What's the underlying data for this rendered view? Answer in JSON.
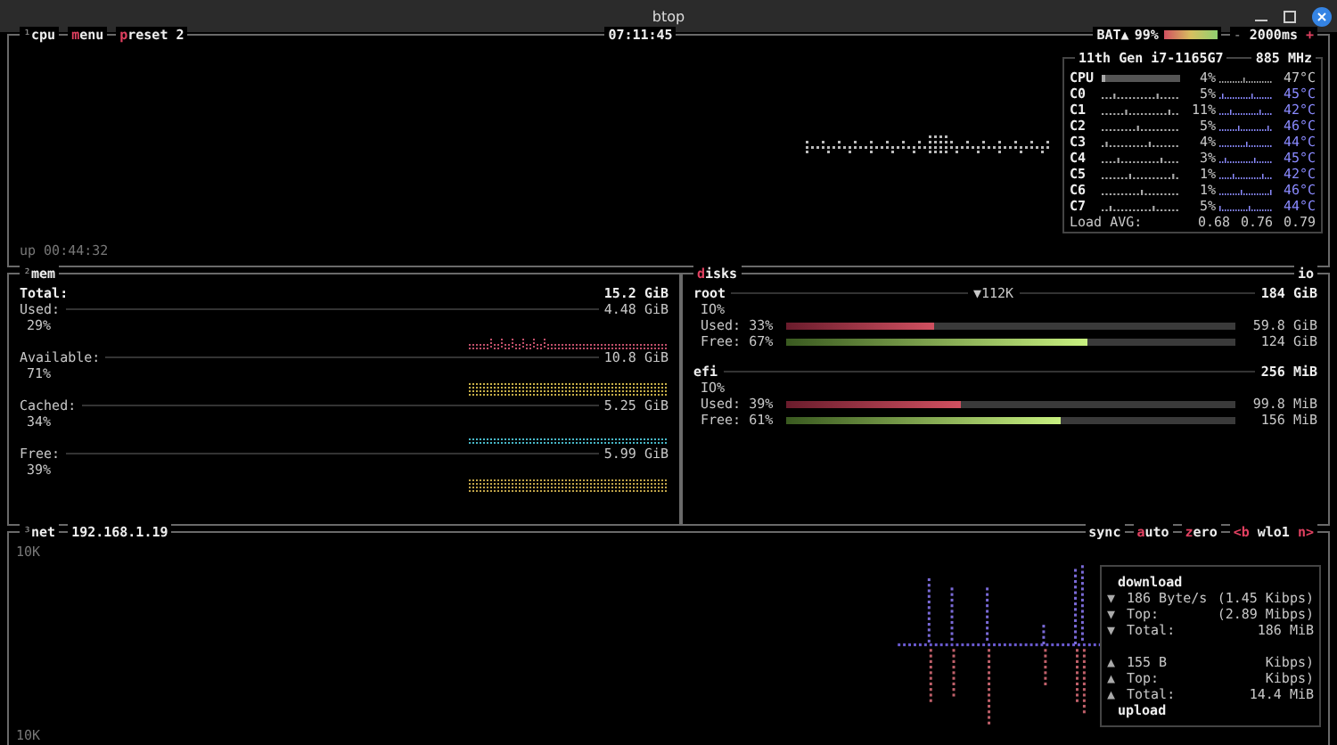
{
  "window": {
    "title": "btop"
  },
  "cpu": {
    "tags": [
      {
        "kind": "numbered",
        "key": "¹",
        "text": "cpu"
      },
      {
        "kind": "hotkey",
        "key": "m",
        "text": "enu"
      },
      {
        "kind": "hotkey",
        "key": "p",
        "text": "reset 2"
      }
    ],
    "clock": "07:11:45",
    "battery": {
      "label": "BAT▲",
      "reading": "99%",
      "level": 0.99
    },
    "interval": {
      "minus": "-",
      "text": "2000ms",
      "plus": "+"
    },
    "uptime": "up 00:44:32",
    "info": {
      "model": "11th Gen i7-1165G7",
      "speed": "885 MHz",
      "rows": [
        {
          "name": "CPU",
          "kind": "total",
          "level": 0.04,
          "reading": "4%",
          "temp": "47°C"
        },
        {
          "name": "C0",
          "kind": "core",
          "reading": "5%",
          "temp": "45°C"
        },
        {
          "name": "C1",
          "kind": "core",
          "reading": "11%",
          "temp": "42°C"
        },
        {
          "name": "C2",
          "kind": "core",
          "reading": "5%",
          "temp": "46°C"
        },
        {
          "name": "C3",
          "kind": "core",
          "reading": "4%",
          "temp": "44°C"
        },
        {
          "name": "C4",
          "kind": "core",
          "reading": "3%",
          "temp": "45°C"
        },
        {
          "name": "C5",
          "kind": "core",
          "reading": "1%",
          "temp": "42°C"
        },
        {
          "name": "C6",
          "kind": "core",
          "reading": "1%",
          "temp": "46°C"
        },
        {
          "name": "C7",
          "kind": "core",
          "reading": "5%",
          "temp": "44°C"
        }
      ],
      "load": {
        "label": "Load AVG:",
        "values": [
          "0.68",
          "0.76",
          "0.79"
        ]
      }
    }
  },
  "mem": {
    "tag": {
      "key": "²",
      "text": "mem"
    },
    "total": {
      "label": "Total:",
      "value": "15.2 GiB"
    },
    "rows": [
      {
        "label": "Used:",
        "value": "4.48 GiB",
        "percent": "29%",
        "color": "#c0506a"
      },
      {
        "label": "Available:",
        "value": "10.8 GiB",
        "percent": "71%",
        "color": "#c8b048"
      },
      {
        "label": "Cached:",
        "value": "5.25 GiB",
        "percent": "34%",
        "color": "#48b8c8"
      },
      {
        "label": "Free:",
        "value": "5.99 GiB",
        "percent": "39%",
        "color": "#c0a448"
      }
    ]
  },
  "disks": {
    "tag": {
      "key": "d",
      "text": "isks"
    },
    "side_tag": "io",
    "items": [
      {
        "name": "root",
        "io": "▼112K",
        "size": "184 GiB",
        "io_label": "IO%",
        "bars": [
          {
            "label": "Used: 33%",
            "kind": "used",
            "level": 0.33,
            "value": "59.8 GiB"
          },
          {
            "label": "Free: 67%",
            "kind": "free",
            "level": 0.67,
            "value": "124 GiB"
          }
        ]
      },
      {
        "name": "efi",
        "size": "256 MiB",
        "io_label": "IO%",
        "bars": [
          {
            "label": "Used: 39%",
            "kind": "used",
            "level": 0.39,
            "value": "99.8 MiB"
          },
          {
            "label": "Free: 61%",
            "kind": "free",
            "level": 0.61,
            "value": "156 MiB"
          }
        ]
      }
    ]
  },
  "net": {
    "tag": {
      "key": "³",
      "text": "net"
    },
    "address": "192.168.1.19",
    "controls": [
      {
        "kind": "plain",
        "text": "sync"
      },
      {
        "kind": "hotkey",
        "key": "a",
        "text": "uto"
      },
      {
        "kind": "hotkey",
        "key": "z",
        "text": "ero"
      },
      {
        "kind": "interface",
        "left": "<b",
        "text": "wlo1",
        "right": "n>"
      }
    ],
    "scale_top": "10K",
    "scale_bottom": "10K",
    "download": {
      "title": "download",
      "rows": [
        {
          "arrow": "▼",
          "label": "186 Byte/s",
          "value": "(1.45 Kibps)"
        },
        {
          "arrow": "▼",
          "label": "Top:",
          "value": "(2.89 Mibps)"
        },
        {
          "arrow": "▼",
          "label": "Total:",
          "value": "186 MiB"
        }
      ]
    },
    "upload": {
      "title": "upload",
      "rows": [
        {
          "arrow": "▲",
          "label": "155 B",
          "value": "Kibps)"
        },
        {
          "arrow": "▲",
          "label": "Top:",
          "value": "Kibps)"
        },
        {
          "arrow": "▲",
          "label": "Total:",
          "value": "14.4 MiB"
        }
      ]
    }
  }
}
